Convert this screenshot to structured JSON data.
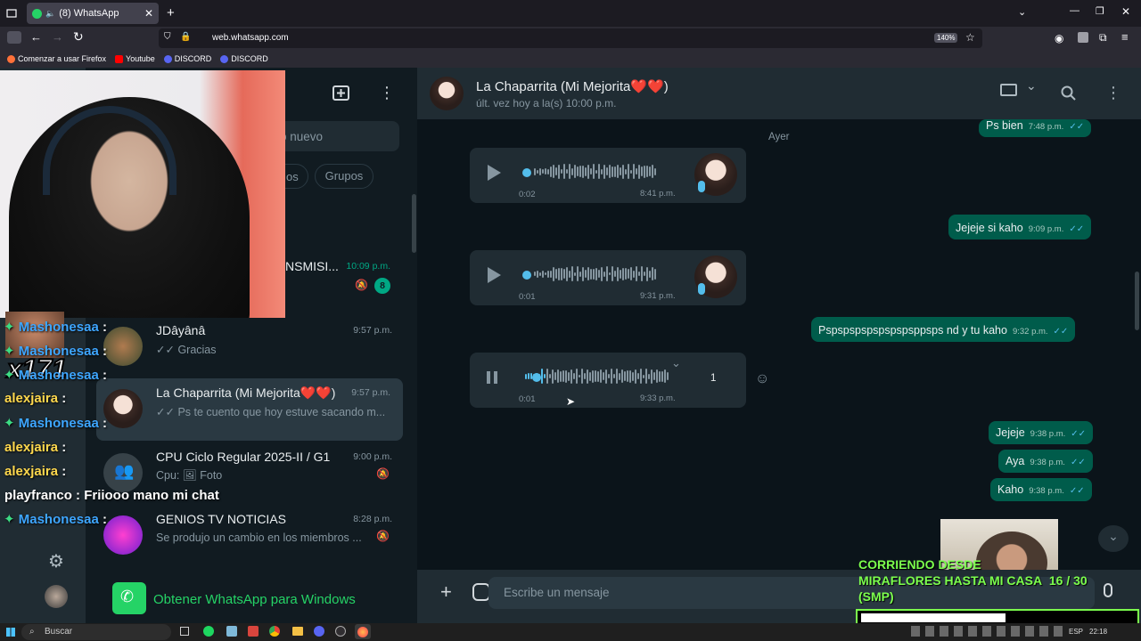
{
  "browser": {
    "tab_title": "(8) WhatsApp",
    "url": "web.whatsapp.com",
    "zoom": "140%",
    "bookmarks": [
      {
        "label": "Comenzar a usar Firefox",
        "color": "#ff7139"
      },
      {
        "label": "Youtube",
        "color": "#ff0000"
      },
      {
        "label": "DISCORD",
        "color": "#5865f2"
      },
      {
        "label": "DISCORD",
        "color": "#5865f2"
      }
    ]
  },
  "sidebar": {
    "search_placeholder": "o nuevo",
    "filter_partial": "os",
    "filter_groups": "Grupos",
    "get_app": "Obtener WhatsApp para Windows",
    "chats": [
      {
        "name": "NSMISI...",
        "time": "10:09 p.m.",
        "preview": "",
        "badge": "8"
      },
      {
        "name": "JDâyânâ",
        "time": "9:57 p.m.",
        "preview": "Gracias"
      },
      {
        "name": "La Chaparrita (Mi Mejorita❤️❤️)",
        "time": "9:57 p.m.",
        "preview": "Ps te cuento que hoy estuve sacando m..."
      },
      {
        "name": "CPU Ciclo Regular 2025-II / G1",
        "time": "9:00 p.m.",
        "preview_prefix": "Cpu:",
        "preview": "Foto"
      },
      {
        "name": "GENIOS TV NOTICIAS",
        "time": "8:28 p.m.",
        "preview": "Se produjo un cambio en los miembros ..."
      }
    ]
  },
  "chat": {
    "title": "La Chaparrita (Mi Mejorita❤️❤️)",
    "status": "últ. vez hoy a la(s) 10:00 p.m.",
    "day_label": "Ayer",
    "composer_placeholder": "Escribe un mensaje",
    "messages": [
      {
        "text": "Ps bien",
        "time": "7:48 p.m."
      },
      {
        "voice_duration": "0:02",
        "time": "8:41 p.m."
      },
      {
        "text": "Jejeje si kaho",
        "time": "9:09 p.m."
      },
      {
        "voice_duration": "0:01",
        "time": "9:31 p.m."
      },
      {
        "text": "Pspspspspspspspsppsps nd y tu kaho",
        "time": "9:32 p.m."
      },
      {
        "voice_duration": "0:01",
        "time": "9:33 p.m.",
        "speed": "1",
        "playing": true
      },
      {
        "text": "Jejeje",
        "time": "9:38 p.m."
      },
      {
        "text": "Aya",
        "time": "9:38 p.m."
      },
      {
        "text": "Kaho",
        "time": "9:38 p.m."
      }
    ]
  },
  "stream_chat": [
    {
      "user": "Mashonesaa",
      "color": "#3ea6ff",
      "msg": ":"
    },
    {
      "user": "Mashonesaa",
      "color": "#3ea6ff",
      "msg": ":"
    },
    {
      "user": "Mashonesaa",
      "color": "#3ea6ff",
      "msg": ":"
    },
    {
      "user": "alexjaira",
      "color": "#ffd84d",
      "msg": ":"
    },
    {
      "user": "Mashonesaa",
      "color": "#3ea6ff",
      "msg": ":"
    },
    {
      "user": "alexjaira",
      "color": "#ffd84d",
      "msg": ":"
    },
    {
      "user": "alexjaira",
      "color": "#ffd84d",
      "msg": ":"
    },
    {
      "user": "playfranco",
      "color": "#ffffff",
      "msg": ": Friiooo mano mi chat"
    },
    {
      "user": "Mashonesaa",
      "color": "#3ea6ff",
      "msg": ":"
    }
  ],
  "stream_overlay": {
    "combo": "x171",
    "goal_line1": "CORRIENDO DESDE",
    "goal_line2": "MIRAFLORES HASTA MI CASA",
    "goal_count": "16   / 30",
    "goal_suffix": "(SMP)",
    "progress": 0.53
  },
  "taskbar": {
    "search_label": "Buscar",
    "lang": "ESP",
    "clock": "22:18"
  },
  "colors": {
    "accent": "#00a884",
    "outgoing": "#005c4b",
    "incoming": "#202c33"
  }
}
